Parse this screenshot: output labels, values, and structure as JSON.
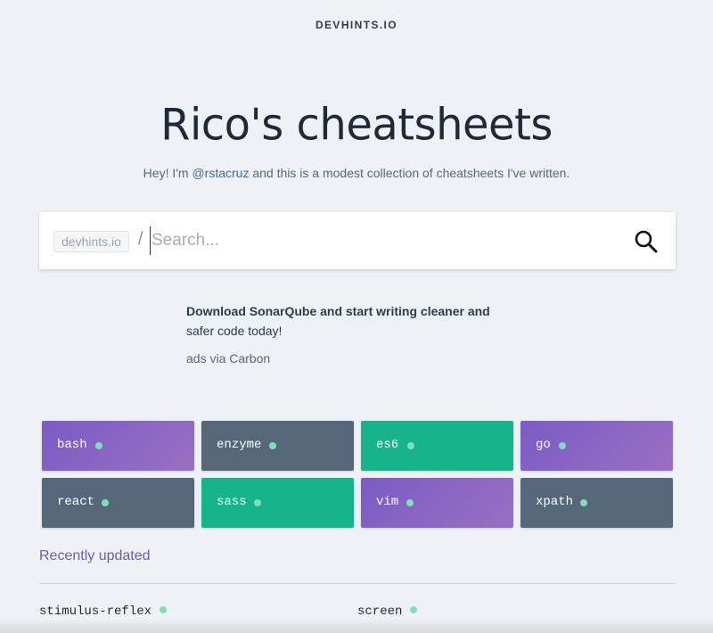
{
  "header": {
    "brand": "DEVHINTS.IO"
  },
  "hero": {
    "title": "Rico's cheatsheets",
    "tagline_pre": "Hey! I'm ",
    "tagline_link": "@rstacruz",
    "tagline_post": " and this is a modest collection of cheatsheets I've written."
  },
  "search": {
    "prefix": "devhints.io",
    "separator": "/",
    "placeholder": "Search...",
    "value": "",
    "icon": "search-icon"
  },
  "ad": {
    "headline": "Download SonarQube and start writing cleaner and",
    "body": "safer code today!",
    "via": "ads via Carbon"
  },
  "tiles": [
    {
      "label": "bash",
      "color": "purple"
    },
    {
      "label": "enzyme",
      "color": "slate"
    },
    {
      "label": "es6",
      "color": "green"
    },
    {
      "label": "go",
      "color": "purple"
    },
    {
      "label": "react",
      "color": "slate"
    },
    {
      "label": "sass",
      "color": "green"
    },
    {
      "label": "vim",
      "color": "purple"
    },
    {
      "label": "xpath",
      "color": "slate"
    }
  ],
  "colors": {
    "purple_start": "#7a5cc4",
    "purple_end": "#9a6fc3",
    "slate": "#56677a",
    "green": "#17b38a",
    "dot": "#7fe0b8",
    "section_title": "#6e5bb0",
    "link": "#3b6d9e"
  },
  "recent": {
    "title": "Recently updated",
    "items": [
      "stimulus-reflex",
      "screen"
    ]
  }
}
